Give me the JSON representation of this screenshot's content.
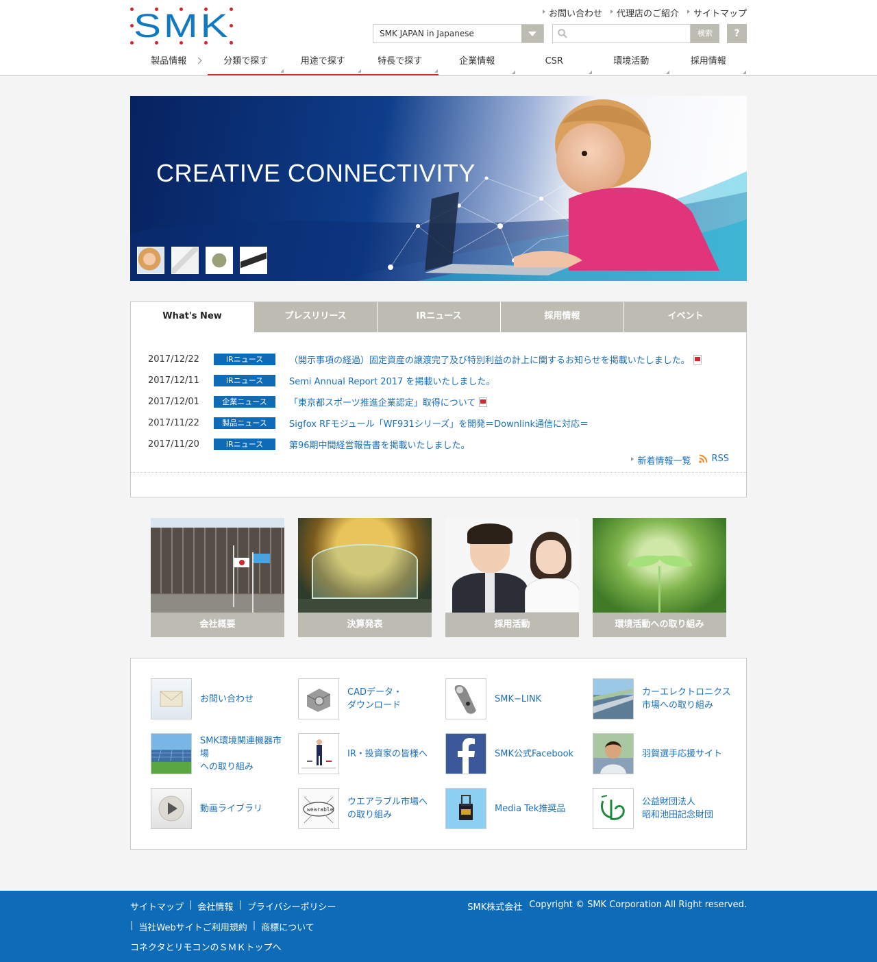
{
  "brand": {
    "logo_text": "SMK",
    "logo_color": "#1079c1",
    "dot_color": "#d7252d"
  },
  "utility_links": [
    "お問い合わせ",
    "代理店のご紹介",
    "サイトマップ"
  ],
  "language_select": {
    "selected": "SMK JAPAN in Japanese"
  },
  "search": {
    "placeholder": "",
    "button_label": "検索",
    "help_label": "?"
  },
  "global_nav": [
    "製品情報",
    "分類で探す",
    "用途で探す",
    "特長で探す",
    "企業情報",
    "CSR",
    "環境活動",
    "採用情報"
  ],
  "hero": {
    "title": "CREATIVE CONNECTIVITY",
    "thumbnails": [
      "girl-thumbnail",
      "documents-thumbnail",
      "module-thumbnail",
      "connector-thumbnail"
    ]
  },
  "news": {
    "tabs": [
      "What's New",
      "プレスリリース",
      "IRニュース",
      "採用情報",
      "イベント"
    ],
    "items": [
      {
        "date": "2017/12/22",
        "category": "IRニュース",
        "title": "（開示事項の経過）固定資産の譲渡完了及び特別利益の計上に関するお知らせを掲載いたしました。",
        "pdf": true
      },
      {
        "date": "2017/12/11",
        "category": "IRニュース",
        "title": "Semi Annual Report 2017 を掲載いたしました。",
        "pdf": false
      },
      {
        "date": "2017/12/01",
        "category": "企業ニュース",
        "title": "「東京都スポーツ推進企業認定」取得について",
        "pdf": true
      },
      {
        "date": "2017/11/22",
        "category": "製品ニュース",
        "title": "Sigfox RFモジュール「WF931シリーズ」を開発＝Downlink通信に対応＝",
        "pdf": false
      },
      {
        "date": "2017/11/20",
        "category": "IRニュース",
        "title": "第96期中間経営報告書を掲載いたしました。",
        "pdf": false
      }
    ],
    "more_label": "新着情報一覧",
    "rss_label": "RSS"
  },
  "feature_cards": [
    "会社概要",
    "決算発表",
    "採用活動",
    "環境活動への取り組み"
  ],
  "link_grid": [
    "お問い合わせ",
    "CADデータ・\nダウンロード",
    "SMK−LINK",
    "カーエレクトロニクス\n市場への取り組み",
    "SMK環境関連機器市場\nへの取り組み",
    "IR・投資家の皆様へ",
    "SMK公式Facebook",
    "羽賀選手応援サイト",
    "動画ライブラリ",
    "ウエアラブル市場へ\nの取り組み",
    "Media Tek推奨品",
    "公益財団法人\n昭和池田記念財団"
  ],
  "footer": {
    "links_row1": [
      "サイトマップ",
      "会社情報",
      "プライバシーポリシー"
    ],
    "links_row2": [
      "当社Webサイトご利用規約",
      "商標について"
    ],
    "top_link": "コネクタとリモコンのＳＭＫトップへ",
    "company": "SMK株式会社",
    "copyright": "Copyright © SMK Corporation All Right reserved."
  },
  "colors": {
    "accent_blue": "#0d6bb8",
    "link_blue": "#1a6fbd",
    "tab_gray": "#bdbcb2",
    "nav_red": "#d7252d"
  }
}
